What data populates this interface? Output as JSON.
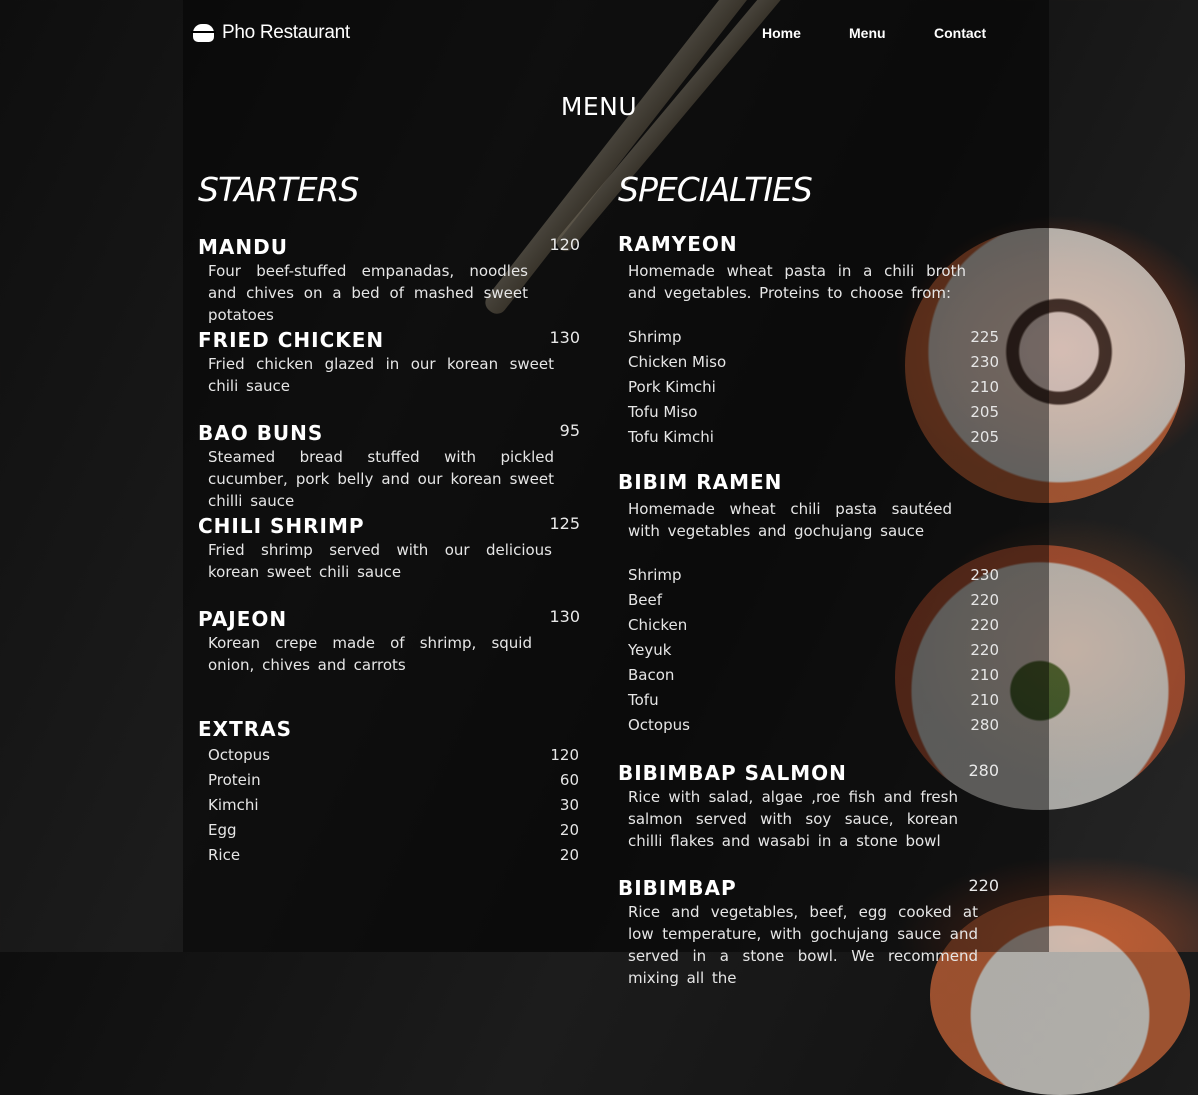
{
  "nav": {
    "brand": "Pho Restaurant",
    "links": [
      "Home",
      "Menu",
      "Contact"
    ]
  },
  "page_title": "MENU",
  "starters": {
    "heading": "STARTERS",
    "items": [
      {
        "name": "MANDU",
        "price": "120",
        "desc": "Four beef-stuffed empanadas, noodles and chives on a bed of mashed sweet potatoes"
      },
      {
        "name": "FRIED CHICKEN",
        "price": "130",
        "desc": "Fried chicken glazed in our korean sweet chili sauce"
      },
      {
        "name": "BAO BUNS",
        "price": "95",
        "desc": "Steamed bread stuffed with pickled cucumber, pork belly and our korean sweet chilli sauce"
      },
      {
        "name": "CHILI SHRIMP",
        "price": "125",
        "desc": "Fried shrimp served with our delicious korean sweet chili sauce"
      },
      {
        "name": "PAJEON",
        "price": "130",
        "desc": "Korean crepe made of shrimp, squid onion, chives and carrots"
      }
    ]
  },
  "extras": {
    "heading": "EXTRAS",
    "items": [
      {
        "name": "Octopus",
        "price": "120"
      },
      {
        "name": "Protein",
        "price": "60"
      },
      {
        "name": "Kimchi",
        "price": "30"
      },
      {
        "name": "Egg",
        "price": "20"
      },
      {
        "name": "Rice",
        "price": "20"
      }
    ]
  },
  "specialties": {
    "heading": "SPECIALTIES",
    "ramyeon": {
      "name": "RAMYEON",
      "desc": "Homemade wheat pasta in a chili broth and vegetables. Proteins to choose from:",
      "options": [
        {
          "name": "Shrimp",
          "price": "225"
        },
        {
          "name": "Chicken Miso",
          "price": "230"
        },
        {
          "name": "Pork Kimchi",
          "price": "210"
        },
        {
          "name": "Tofu Miso",
          "price": "205"
        },
        {
          "name": "Tofu Kimchi",
          "price": "205"
        }
      ]
    },
    "bibim_ramen": {
      "name": "BIBIM RAMEN",
      "desc": "Homemade wheat chili pasta sautéed with vegetables and gochujang sauce",
      "options": [
        {
          "name": "Shrimp",
          "price": "230"
        },
        {
          "name": "Beef",
          "price": "220"
        },
        {
          "name": "Chicken",
          "price": "220"
        },
        {
          "name": "Yeyuk",
          "price": "220"
        },
        {
          "name": "Bacon",
          "price": "210"
        },
        {
          "name": "Tofu",
          "price": "210"
        },
        {
          "name": "Octopus",
          "price": "280"
        }
      ]
    },
    "bibimbap_salmon": {
      "name": "BIBIMBAP SALMON",
      "price": "280",
      "desc": "Rice with salad, algae ,roe fish and fresh salmon served with soy sauce, korean chilli flakes and wasabi in a stone bowl"
    },
    "bibimbap": {
      "name": "BIBIMBAP",
      "price": "220",
      "desc": "Rice and vegetables, beef, egg cooked at low temperature, with gochujang sauce and served in a stone bowl. We recommend mixing all the"
    }
  }
}
